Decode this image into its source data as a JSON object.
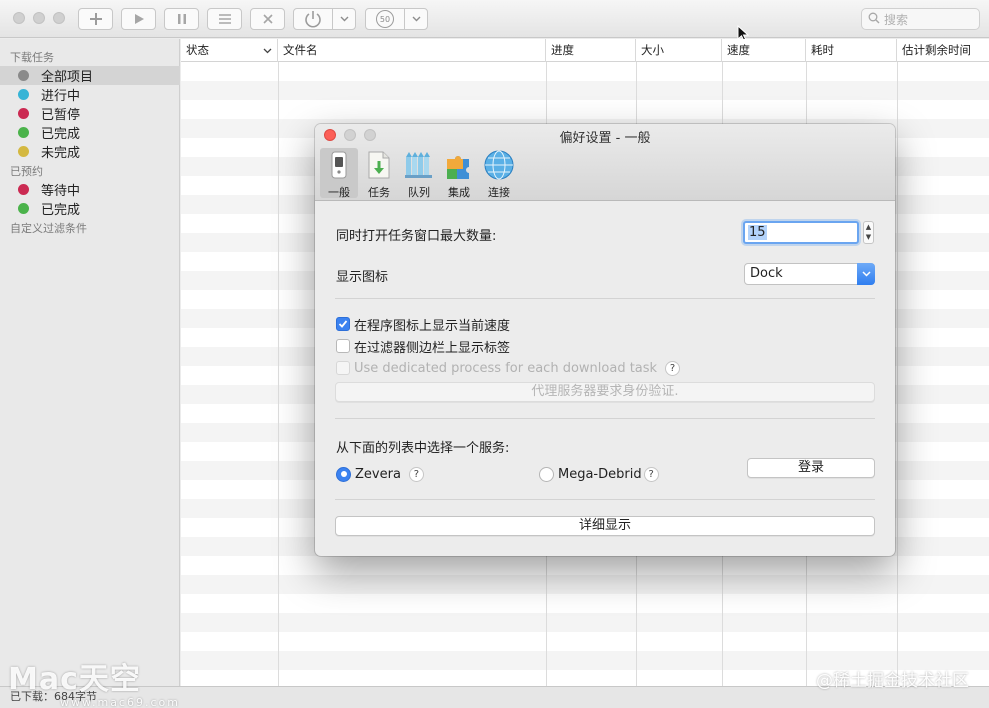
{
  "toolbar": {
    "search_placeholder": "搜索",
    "icons": [
      "add-icon",
      "play-icon",
      "pause-icon",
      "list-icon",
      "close-icon",
      "power-icon",
      "speed-limit-icon"
    ],
    "speed_limit_value": "50"
  },
  "sidebar": {
    "section_downloads": "下载任务",
    "items": [
      {
        "label": "全部项目",
        "color": "#8a8a8a"
      },
      {
        "label": "进行中",
        "color": "#37b4d6"
      },
      {
        "label": "已暂停",
        "color": "#cb2a52"
      },
      {
        "label": "已完成",
        "color": "#4bb34b"
      },
      {
        "label": "未完成",
        "color": "#d4b840"
      }
    ],
    "section_scheduled": "已预约",
    "scheduled_items": [
      {
        "label": "等待中",
        "color": "#cb2a52"
      },
      {
        "label": "已完成",
        "color": "#4bb34b"
      }
    ],
    "section_filters": "自定义过滤条件"
  },
  "table": {
    "columns": [
      "状态",
      "文件名",
      "进度",
      "大小",
      "速度",
      "耗时",
      "估计剩余时间"
    ]
  },
  "statusbar": {
    "text": "已下载：684字节"
  },
  "watermark": {
    "logo": "Mac天空",
    "url": "www.mac69.com",
    "right": "@稀土掘金技术社区"
  },
  "dialog": {
    "title": "偏好设置 - 一般",
    "tabs": [
      {
        "label": "一般",
        "icon": "general-icon"
      },
      {
        "label": "任务",
        "icon": "tasks-icon"
      },
      {
        "label": "队列",
        "icon": "queue-icon"
      },
      {
        "label": "集成",
        "icon": "integration-icon"
      },
      {
        "label": "连接",
        "icon": "connection-icon"
      }
    ],
    "max_windows_label": "同时打开任务窗口最大数量:",
    "max_windows_value": "15",
    "show_icon_label": "显示图标",
    "show_icon_value": "Dock",
    "checkboxes": [
      {
        "label": "在程序图标上显示当前速度",
        "checked": true
      },
      {
        "label": "在过滤器侧边栏上显示标签",
        "checked": false
      },
      {
        "label": "Use dedicated process for each download task",
        "checked": false,
        "disabled": true
      }
    ],
    "proxy_auth_button": "代理服务器要求身份验证.",
    "service_label": "从下面的列表中选择一个服务:",
    "services": [
      {
        "label": "Zevera",
        "selected": true
      },
      {
        "label": "Mega-Debrid",
        "selected": false
      }
    ],
    "login_button": "登录",
    "details_button": "详细显示"
  }
}
